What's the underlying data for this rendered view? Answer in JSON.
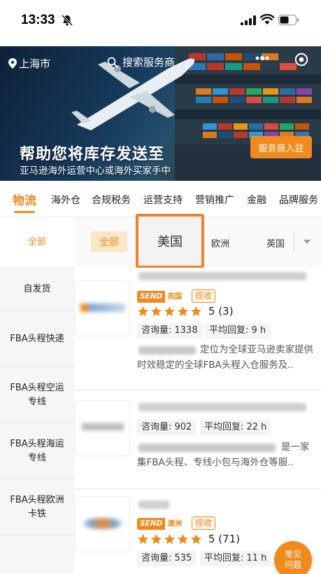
{
  "status_bar": {
    "time": "13:33"
  },
  "header": {
    "location": "上海市",
    "search_placeholder": "搜索服务商"
  },
  "banner": {
    "title": "帮助您将库存发送至",
    "subtitle": "亚马逊海外运营中心或海外买家手中",
    "cta_label": "服务商入驻"
  },
  "category_tabs": [
    {
      "label": "物流",
      "active": true
    },
    {
      "label": "海外仓",
      "active": false
    },
    {
      "label": "合规税务",
      "active": false
    },
    {
      "label": "运营支持",
      "active": false
    },
    {
      "label": "营销推广",
      "active": false
    },
    {
      "label": "金融",
      "active": false
    },
    {
      "label": "品牌服务",
      "active": false
    }
  ],
  "sidebar": {
    "items": [
      {
        "label": "全部",
        "active": true
      },
      {
        "label": "自发货",
        "active": false
      },
      {
        "label": "FBA头程快递",
        "active": false
      },
      {
        "label": "FBA头程空运专线",
        "active": false
      },
      {
        "label": "FBA头程海运专线",
        "active": false
      },
      {
        "label": "FBA头程欧洲卡铁",
        "active": false
      }
    ]
  },
  "regions": {
    "all": "全部",
    "us": "美国",
    "eu": "欧洲",
    "uk": "英国"
  },
  "listings": [
    {
      "send_badge": "SEND",
      "send_region": "英国",
      "collect_label": "揽收",
      "rating": 5,
      "rating_text": "5 (3)",
      "consult_label": "咨询量: 1338",
      "reply_label": "平均回复: 9 h",
      "desc_line1": "定位为全球亚马逊卖家提供",
      "desc_line2": "时效稳定的全球FBA头程入仓服务及.."
    },
    {
      "consult_label": "咨询量: 902",
      "reply_label": "平均回复: 22 h",
      "desc_line1": "是一家",
      "desc_line2": "集FBA头程、专线小包与海外仓等服.."
    },
    {
      "send_badge": "SEND",
      "send_region": "澳洲",
      "collect_label": "揽收",
      "rating": 5,
      "rating_text": "5 (71)",
      "consult_label": "咨询量: 535",
      "reply_label": "平均回复: 11 h"
    }
  ],
  "help_button": {
    "line1": "常见",
    "line2": "问题"
  },
  "colors": {
    "accent": "#f08a1c",
    "highlight_border": "#f3812b"
  }
}
